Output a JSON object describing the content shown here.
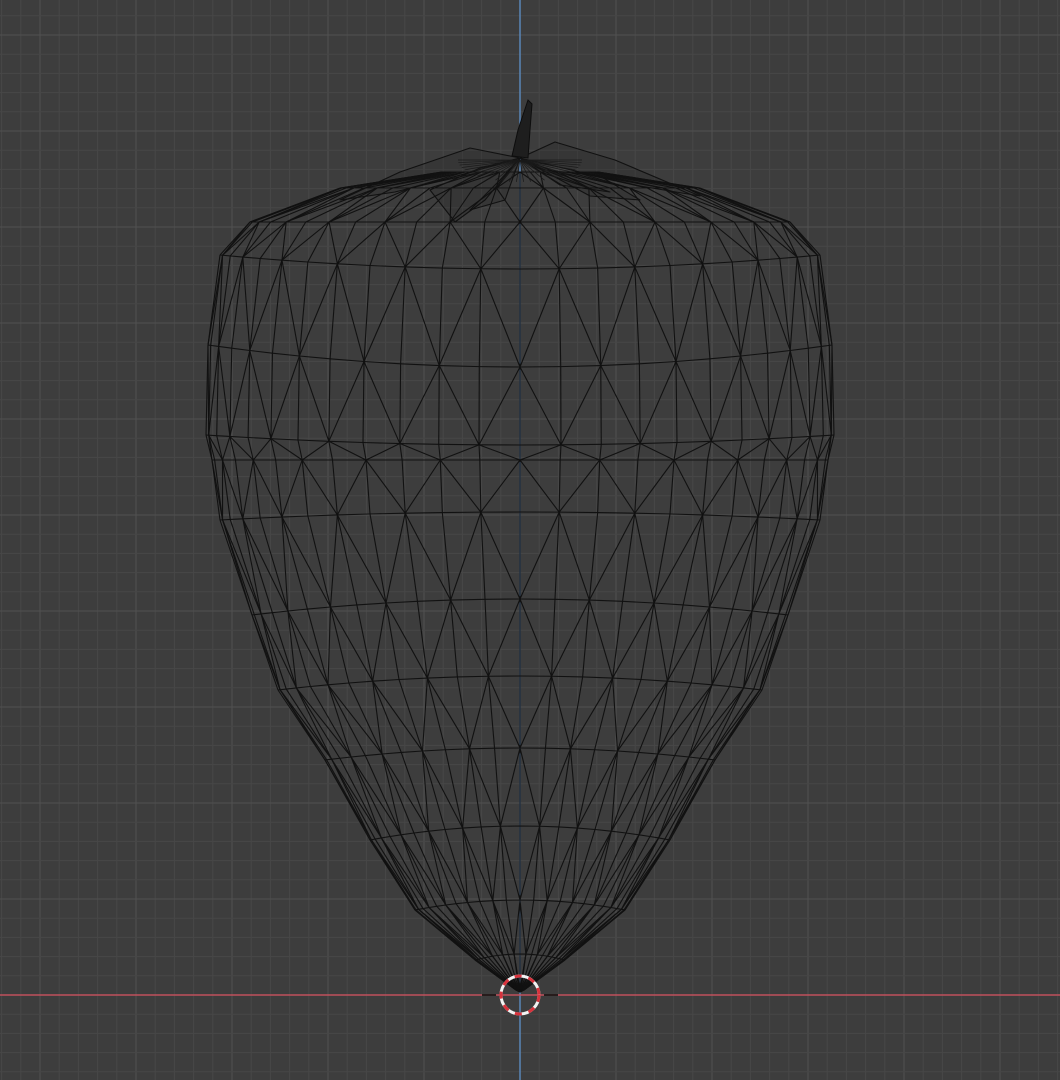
{
  "viewport": {
    "view": "front-orthographic",
    "shading": "wireframe",
    "colors": {
      "background": "#3d3d3d",
      "grid_minor": "#474747",
      "grid_major": "#515151",
      "axis_x": "#c0505c",
      "axis_z": "#5a86b8",
      "wire": "#111111",
      "cursor_red": "#d8323c",
      "cursor_white": "#f2f2f2"
    },
    "grid": {
      "visible": true
    },
    "object": {
      "icon": "strawberry-mesh-icon"
    },
    "cursor": {
      "icon": "3d-cursor-icon"
    }
  }
}
